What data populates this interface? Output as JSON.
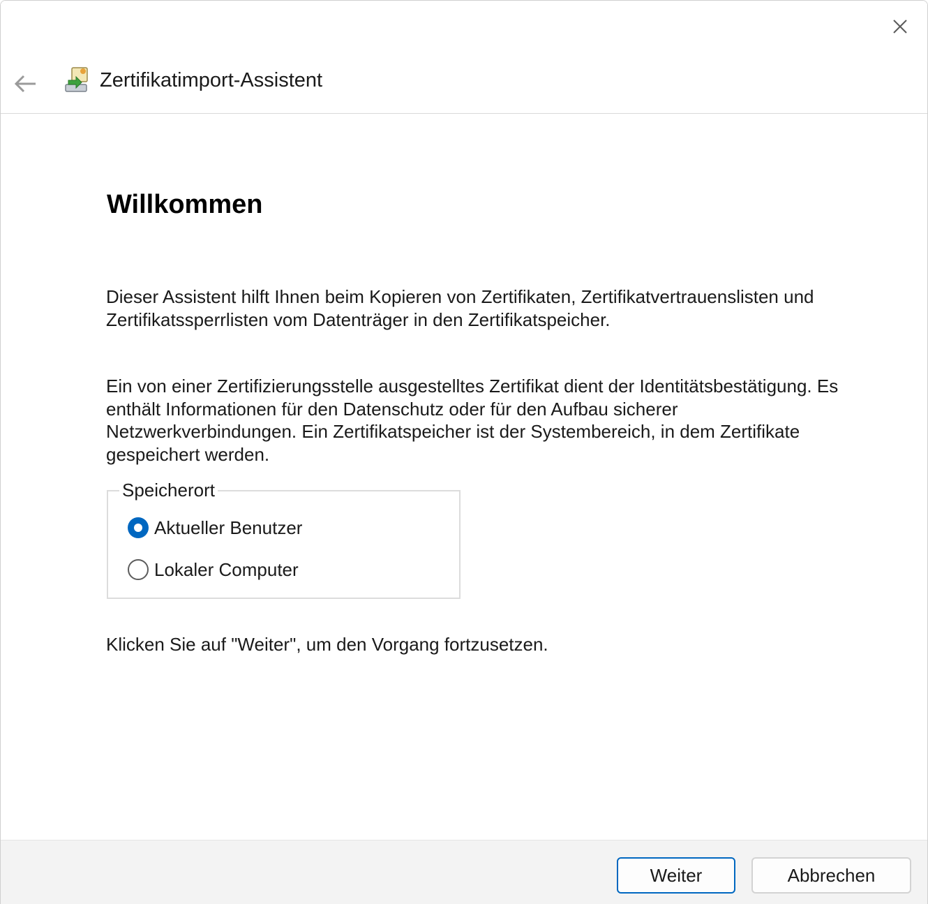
{
  "window": {
    "close_icon": "close-icon"
  },
  "header": {
    "back_icon": "back-arrow-icon",
    "wizard_icon": "certificate-wizard-icon",
    "title": "Zertifikatimport-Assistent"
  },
  "content": {
    "heading": "Willkommen",
    "paragraph1": "Dieser Assistent hilft Ihnen beim Kopieren von Zertifikaten, Zertifikatvertrauenslisten und Zertifikatssperrlisten vom Datenträger in den Zertifikatspeicher.",
    "paragraph2": "Ein von einer Zertifizierungsstelle ausgestelltes Zertifikat dient der Identitätsbestätigung. Es enthält Informationen für den Datenschutz oder für den Aufbau sicherer Netzwerkverbindungen. Ein Zertifikatspeicher ist der Systembereich, in dem Zertifikate gespeichert werden.",
    "store_location": {
      "legend": "Speicherort",
      "options": [
        {
          "label": "Aktueller Benutzer",
          "selected": true
        },
        {
          "label": "Lokaler Computer",
          "selected": false
        }
      ]
    },
    "paragraph3": "Klicken Sie auf \"Weiter\", um den Vorgang fortzusetzen."
  },
  "footer": {
    "next_label": "Weiter",
    "cancel_label": "Abbrechen"
  },
  "colors": {
    "accent": "#0067c0",
    "footer_bg": "#f3f3f3"
  }
}
